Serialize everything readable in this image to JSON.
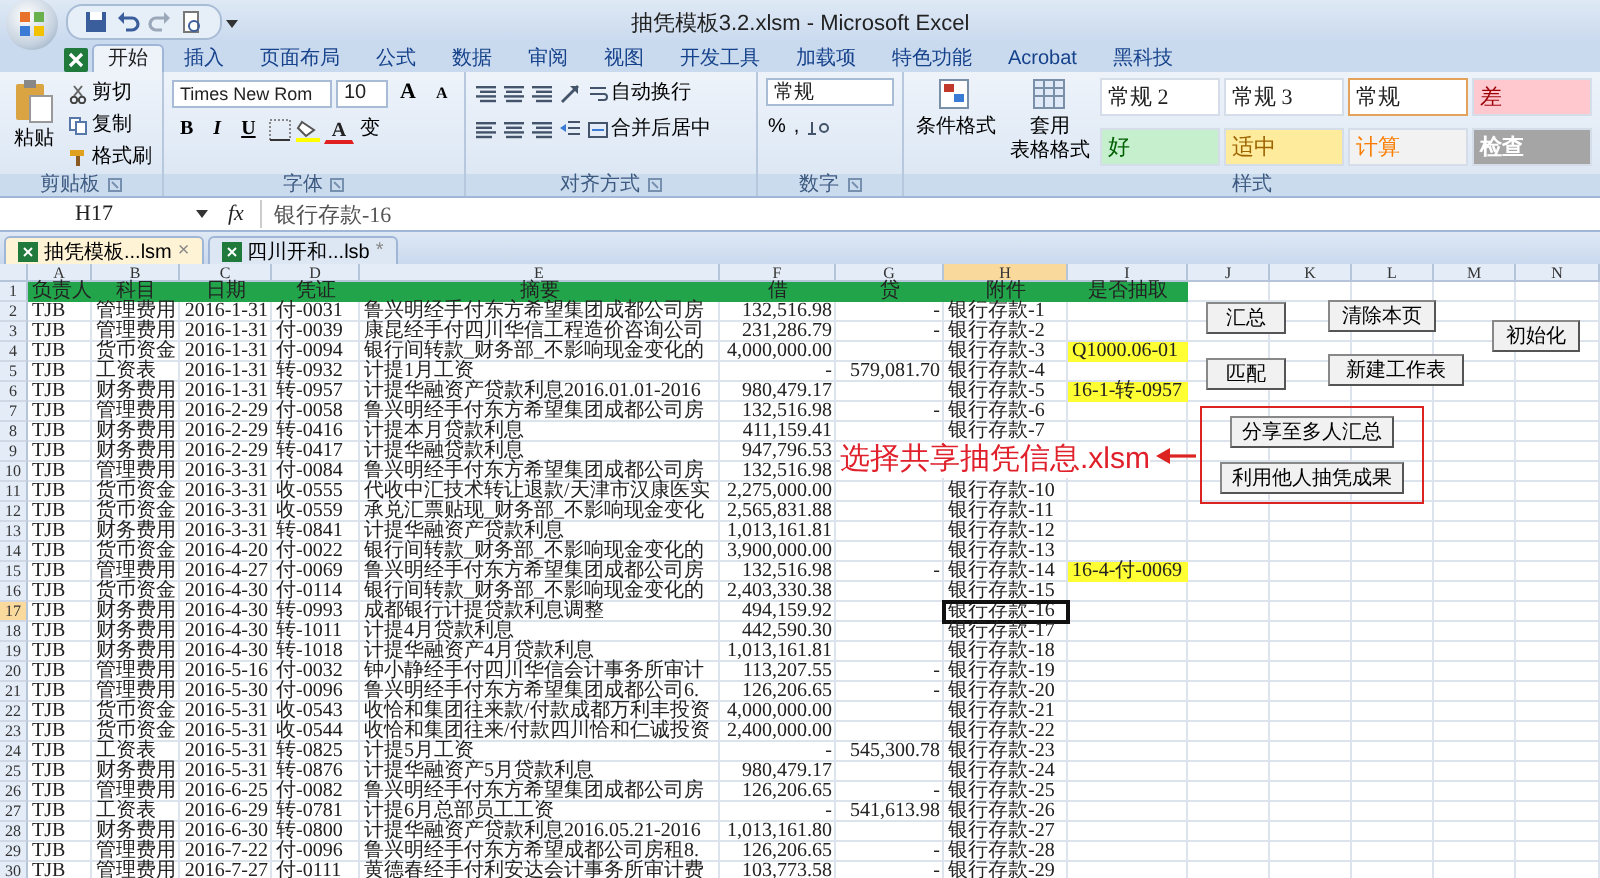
{
  "title_bar": {
    "title": "抽凭模板3.2.xlsm - Microsoft Excel"
  },
  "ribbon_tabs": [
    {
      "label": "开始",
      "selected": true
    },
    {
      "label": "插入",
      "selected": false
    },
    {
      "label": "页面布局",
      "selected": false
    },
    {
      "label": "公式",
      "selected": false
    },
    {
      "label": "数据",
      "selected": false
    },
    {
      "label": "审阅",
      "selected": false
    },
    {
      "label": "视图",
      "selected": false
    },
    {
      "label": "开发工具",
      "selected": false
    },
    {
      "label": "加载项",
      "selected": false
    },
    {
      "label": "特色功能",
      "selected": false
    },
    {
      "label": "Acrobat",
      "selected": false
    },
    {
      "label": "黑科技",
      "selected": false
    }
  ],
  "ribbon": {
    "clipboard": {
      "paste": "粘贴",
      "cut": "剪切",
      "copy": "复制",
      "format_painter": "格式刷",
      "label": "剪贴板"
    },
    "font": {
      "name": "Times New Rom",
      "size": "10",
      "grow": "A",
      "shrink": "A",
      "bold": "B",
      "italic": "I",
      "underline": "U",
      "font_color": "A",
      "phonetic": "变",
      "label": "字体"
    },
    "alignment": {
      "wrap": "自动换行",
      "merge": "合并后居中",
      "label": "对齐方式"
    },
    "number": {
      "format": "常规",
      "percent": "%",
      "comma": ",",
      "label": "数字"
    },
    "styles": {
      "conditional": "条件格式",
      "table_format": "套用",
      "table_format_2": "表格格式",
      "label": "样式",
      "cells": [
        {
          "label": "常规 2",
          "kind": "normal",
          "selected": false
        },
        {
          "label": "常规 3",
          "kind": "normal",
          "selected": false
        },
        {
          "label": "常规",
          "kind": "normal",
          "selected": true
        },
        {
          "label": "差",
          "kind": "bad",
          "selected": false
        },
        {
          "label": "好",
          "kind": "good",
          "selected": false
        },
        {
          "label": "适中",
          "kind": "neutral",
          "selected": false
        },
        {
          "label": "计算",
          "kind": "calc",
          "selected": false
        },
        {
          "label": "检查",
          "kind": "check",
          "selected": false
        }
      ]
    }
  },
  "formula_bar": {
    "name_box": "H17",
    "function_label": "fx",
    "value": "银行存款-16"
  },
  "workbook_tabs": [
    {
      "label": "抽凭模板...lsm",
      "selected": true,
      "mark": "×"
    },
    {
      "label": "四川开和...lsb",
      "selected": false,
      "mark": "*"
    }
  ],
  "sheet": {
    "columns": [
      {
        "label": "A",
        "selected": false
      },
      {
        "label": "B",
        "selected": false
      },
      {
        "label": "C",
        "selected": false
      },
      {
        "label": "D",
        "selected": false
      },
      {
        "label": "E",
        "selected": false
      },
      {
        "label": "F",
        "selected": false
      },
      {
        "label": "G",
        "selected": false
      },
      {
        "label": "H",
        "selected": true
      },
      {
        "label": "I",
        "selected": false
      },
      {
        "label": "J",
        "selected": false
      },
      {
        "label": "K",
        "selected": false
      },
      {
        "label": "L",
        "selected": false
      },
      {
        "label": "M",
        "selected": false
      },
      {
        "label": "N",
        "selected": false
      }
    ],
    "header_row": {
      "num": "1",
      "labels": [
        "负责人",
        "科目",
        "日期",
        "凭证",
        "摘要",
        "借",
        "贷",
        "附件",
        "是否抽取"
      ]
    },
    "rows": [
      {
        "num": "2",
        "selected": false,
        "owner": "TJB",
        "account": "管理费用",
        "date": "2016-1-31",
        "voucher": "付-0031",
        "summary": "鲁兴明经手付东方希望集团成都公司房",
        "debit": "132,516.98",
        "credit": "-",
        "attachment": "银行存款-1"
      },
      {
        "num": "3",
        "selected": false,
        "owner": "TJB",
        "account": "管理费用",
        "date": "2016-1-31",
        "voucher": "付-0039",
        "summary": "康昆经手付四川华信工程造价咨询公司",
        "debit": "231,286.79",
        "credit": "-",
        "attachment": "银行存款-2"
      },
      {
        "num": "4",
        "selected": false,
        "owner": "TJB",
        "account": "货币资金",
        "date": "2016-1-31",
        "voucher": "付-0094",
        "summary": "银行间转款_财务部_不影响现金变化的",
        "debit": "4,000,000.00",
        "attachment": "银行存款-3",
        "sampled": "Q1000.06-01"
      },
      {
        "num": "5",
        "selected": false,
        "owner": "TJB",
        "account": "工资表",
        "date": "2016-1-31",
        "voucher": "转-0932",
        "summary": "计提1月工资",
        "debit": "-",
        "credit": "579,081.70",
        "attachment": "银行存款-4"
      },
      {
        "num": "6",
        "selected": false,
        "owner": "TJB",
        "account": "财务费用",
        "date": "2016-1-31",
        "voucher": "转-0957",
        "summary": "计提华融资产贷款利息2016.01.01-2016",
        "debit": "980,479.17",
        "attachment": "银行存款-5",
        "sampled": "16-1-转-0957"
      },
      {
        "num": "7",
        "selected": false,
        "owner": "TJB",
        "account": "管理费用",
        "date": "2016-2-29",
        "voucher": "付-0058",
        "summary": "鲁兴明经手付东方希望集团成都公司房",
        "debit": "132,516.98",
        "credit": "-",
        "attachment": "银行存款-6"
      },
      {
        "num": "8",
        "selected": false,
        "owner": "TJB",
        "account": "财务费用",
        "date": "2016-2-29",
        "voucher": "转-0416",
        "summary": "计提本月贷款利息",
        "debit": "411,159.41",
        "attachment": "银行存款-7"
      },
      {
        "num": "9",
        "selected": false,
        "owner": "TJB",
        "account": "财务费用",
        "date": "2016-2-29",
        "voucher": "转-0417",
        "summary": "计提华融贷款利息",
        "debit": "947,796.53"
      },
      {
        "num": "10",
        "selected": false,
        "owner": "TJB",
        "account": "管理费用",
        "date": "2016-3-31",
        "voucher": "付-0084",
        "summary": "鲁兴明经手付东方希望集团成都公司房",
        "debit": "132,516.98"
      },
      {
        "num": "11",
        "selected": false,
        "owner": "TJB",
        "account": "货币资金",
        "date": "2016-3-31",
        "voucher": "收-0555",
        "summary": "代收中汇技术转让退款/天津市汉康医实",
        "debit": "2,275,000.00",
        "attachment": "银行存款-10"
      },
      {
        "num": "12",
        "selected": false,
        "owner": "TJB",
        "account": "货币资金",
        "date": "2016-3-31",
        "voucher": "收-0559",
        "summary": "承兑汇票贴现_财务部_不影响现金变化",
        "debit": "2,565,831.88",
        "attachment": "银行存款-11"
      },
      {
        "num": "13",
        "selected": false,
        "owner": "TJB",
        "account": "财务费用",
        "date": "2016-3-31",
        "voucher": "转-0841",
        "summary": "计提华融资产贷款利息",
        "debit": "1,013,161.81",
        "attachment": "银行存款-12"
      },
      {
        "num": "14",
        "selected": false,
        "owner": "TJB",
        "account": "货币资金",
        "date": "2016-4-20",
        "voucher": "付-0022",
        "summary": "银行间转款_财务部_不影响现金变化的",
        "debit": "3,900,000.00",
        "attachment": "银行存款-13"
      },
      {
        "num": "15",
        "selected": false,
        "owner": "TJB",
        "account": "管理费用",
        "date": "2016-4-27",
        "voucher": "付-0069",
        "summary": "鲁兴明经手付东方希望集团成都公司房",
        "debit": "132,516.98",
        "credit": "-",
        "attachment": "银行存款-14",
        "sampled": "16-4-付-0069"
      },
      {
        "num": "16",
        "selected": false,
        "owner": "TJB",
        "account": "货币资金",
        "date": "2016-4-30",
        "voucher": "付-0114",
        "summary": "银行间转款_财务部_不影响现金变化的",
        "debit": "2,403,330.38",
        "attachment": "银行存款-15"
      },
      {
        "num": "17",
        "selected": true,
        "owner": "TJB",
        "account": "财务费用",
        "date": "2016-4-30",
        "voucher": "转-0993",
        "summary": "成都银行计提贷款利息调整",
        "debit": "494,159.92",
        "attachment": "银行存款-16"
      },
      {
        "num": "18",
        "selected": false,
        "owner": "TJB",
        "account": "财务费用",
        "date": "2016-4-30",
        "voucher": "转-1011",
        "summary": "计提4月贷款利息",
        "debit": "442,590.30",
        "attachment": "银行存款-17"
      },
      {
        "num": "19",
        "selected": false,
        "owner": "TJB",
        "account": "财务费用",
        "date": "2016-4-30",
        "voucher": "转-1018",
        "summary": "计提华融资产4月贷款利息",
        "debit": "1,013,161.81",
        "attachment": "银行存款-18"
      },
      {
        "num": "20",
        "selected": false,
        "owner": "TJB",
        "account": "管理费用",
        "date": "2016-5-16",
        "voucher": "付-0032",
        "summary": "钟小静经手付四川华信会计事务所审计",
        "debit": "113,207.55",
        "credit": "-",
        "attachment": "银行存款-19"
      },
      {
        "num": "21",
        "selected": false,
        "owner": "TJB",
        "account": "管理费用",
        "date": "2016-5-30",
        "voucher": "付-0096",
        "summary": "鲁兴明经手付东方希望集团成都公司6.",
        "debit": "126,206.65",
        "credit": "-",
        "attachment": "银行存款-20"
      },
      {
        "num": "22",
        "selected": false,
        "owner": "TJB",
        "account": "货币资金",
        "date": "2016-5-31",
        "voucher": "收-0543",
        "summary": "收恰和集团往来款/付款成都万利丰投资",
        "debit": "4,000,000.00",
        "attachment": "银行存款-21"
      },
      {
        "num": "23",
        "selected": false,
        "owner": "TJB",
        "account": "货币资金",
        "date": "2016-5-31",
        "voucher": "收-0544",
        "summary": "收恰和集团往来/付款四川恰和仁诚投资",
        "debit": "2,400,000.00",
        "attachment": "银行存款-22"
      },
      {
        "num": "24",
        "selected": false,
        "owner": "TJB",
        "account": "工资表",
        "date": "2016-5-31",
        "voucher": "转-0825",
        "summary": "计提5月工资",
        "debit": "-",
        "credit": "545,300.78",
        "attachment": "银行存款-23"
      },
      {
        "num": "25",
        "selected": false,
        "owner": "TJB",
        "account": "财务费用",
        "date": "2016-5-31",
        "voucher": "转-0876",
        "summary": "计提华融资产5月贷款利息",
        "debit": "980,479.17",
        "attachment": "银行存款-24"
      },
      {
        "num": "26",
        "selected": false,
        "owner": "TJB",
        "account": "管理费用",
        "date": "2016-6-25",
        "voucher": "付-0082",
        "summary": "鲁兴明经手付东方希望集团成都公司房",
        "debit": "126,206.65",
        "credit": "-",
        "attachment": "银行存款-25"
      },
      {
        "num": "27",
        "selected": false,
        "owner": "TJB",
        "account": "工资表",
        "date": "2016-6-29",
        "voucher": "转-0781",
        "summary": "计提6月总部员工工资",
        "debit": "-",
        "credit": "541,613.98",
        "attachment": "银行存款-26"
      },
      {
        "num": "28",
        "selected": false,
        "owner": "TJB",
        "account": "财务费用",
        "date": "2016-6-30",
        "voucher": "转-0800",
        "summary": "计提华融资产贷款利息2016.05.21-2016",
        "debit": "1,013,161.80",
        "attachment": "银行存款-27"
      },
      {
        "num": "29",
        "selected": false,
        "owner": "TJB",
        "account": "管理费用",
        "date": "2016-7-22",
        "voucher": "付-0096",
        "summary": "鲁兴明经手付东方希望成都公司房租8.",
        "debit": "126,206.65",
        "credit": "-",
        "attachment": "银行存款-28"
      },
      {
        "num": "30",
        "selected": false,
        "owner": "TJB",
        "account": "管理费用",
        "date": "2016-7-27",
        "voucher": "付-0111",
        "summary": "黄德春经手付利安达会计事务所审计费",
        "debit": "103,773.58",
        "credit": "-",
        "attachment": "银行存款-29"
      }
    ],
    "buttons": [
      "汇总",
      "清除本页",
      "初始化",
      "匹配",
      "新建工作表"
    ],
    "highlighted_buttons": [
      "分享至多人汇总",
      "利用他人抽凭成果"
    ],
    "annotation": "选择共享抽凭信息.xlsm"
  }
}
